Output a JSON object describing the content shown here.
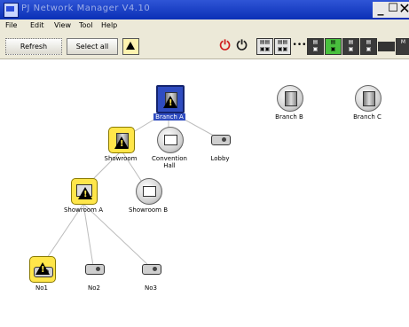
{
  "window": {
    "title": "PJ Network Manager V4.10"
  },
  "menu": [
    {
      "label": "File"
    },
    {
      "label": "Edit"
    },
    {
      "label": "View"
    },
    {
      "label": "Tool"
    },
    {
      "label": "Help"
    }
  ],
  "toolbar": {
    "refresh_label": "Refresh",
    "select_all_label": "Select all",
    "icons": [
      "warning-icon",
      "power-on-icon",
      "power-off-icon",
      "input-1-icon",
      "input-2-icon",
      "dots-icon",
      "input-4-icon",
      "input-5-icon",
      "input-6-icon",
      "input-7-icon",
      "input-8-icon",
      "mp-icon"
    ]
  },
  "nodes": {
    "branch_a": "Branch A",
    "branch_b": "Branch B",
    "branch_c": "Branch C",
    "showroom": "Showroom",
    "convention_hall_1": "Convention",
    "convention_hall_2": "Hall",
    "lobby": "Lobby",
    "showroom_a": "Showroom A",
    "showroom_b": "Showroom B",
    "no1": "No1",
    "no2": "No2",
    "no3": "No3"
  },
  "colors": {
    "selection": "#2f4cc0",
    "warning": "#ffe64a",
    "power_on": "#d01e1e",
    "titlebar": "#0a2fb6"
  }
}
